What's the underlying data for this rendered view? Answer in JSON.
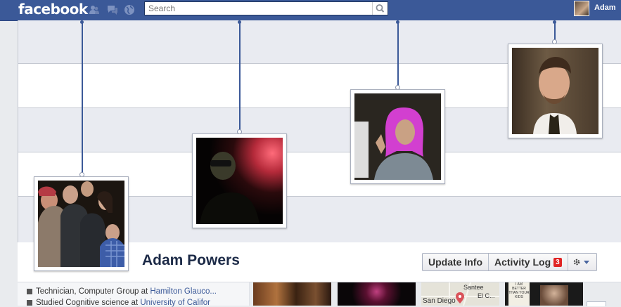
{
  "topbar": {
    "logo": "facebook",
    "search_placeholder": "Search",
    "user_name": "Adam"
  },
  "profile": {
    "name": "Adam Powers",
    "buttons": {
      "update_info": "Update Info",
      "activity_log": "Activity Log",
      "activity_log_count": "3"
    },
    "info": [
      {
        "prefix": "Technician, Computer Group at ",
        "link": "Hamilton Glauco..."
      },
      {
        "prefix": "Studied Cognitive science at ",
        "link": "University of Califor"
      }
    ],
    "map_labels": {
      "top": "Santee",
      "middle": "El C...",
      "bottom": "San Diego"
    },
    "poster_text": "I AM BETTER THAN YOUR KIDS"
  },
  "colors": {
    "brand": "#3b5998",
    "badge": "#e02424",
    "link": "#3b5998"
  },
  "icons": [
    "friend-requests-icon",
    "messages-icon",
    "notifications-globe-icon",
    "search-icon",
    "gear-icon",
    "chevron-down-icon"
  ]
}
